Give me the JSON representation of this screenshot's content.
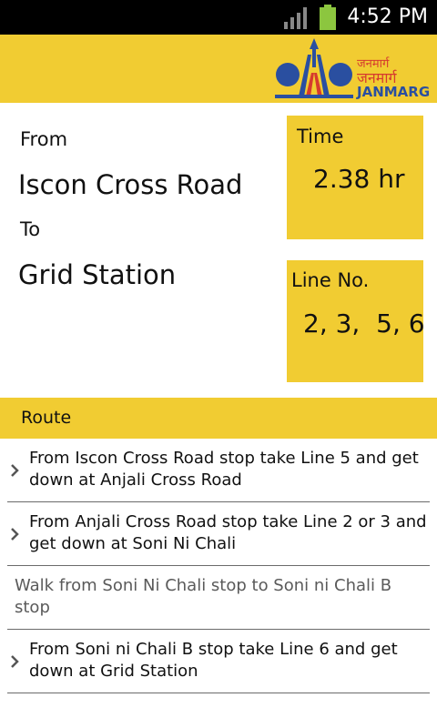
{
  "status_bar": {
    "time": "4:52 PM",
    "icons": [
      "signal-icon",
      "battery-icon"
    ],
    "battery_color": "#8cc63f"
  },
  "header": {
    "brand_hindi_small": "जनमार्ग",
    "brand_hindi_large": "जनमार्ग",
    "brand_name": "JANMARG",
    "accent_color": "#f1cc32"
  },
  "trip": {
    "from_label": "From",
    "from_value": "Iscon Cross Road",
    "to_label": "To",
    "to_value": "Grid Station"
  },
  "time_box": {
    "label": "Time",
    "value": "2.38 hr"
  },
  "line_box": {
    "label": "Line No.",
    "value": "2, 3,  5, 6"
  },
  "route": {
    "header": "Route",
    "steps": [
      {
        "text": "From Iscon Cross Road stop take Line 5 and get down at Anjali Cross Road",
        "icon": "chevron-right-icon"
      },
      {
        "text": "From Anjali Cross Road stop take Line 2 or 3 and get down at Soni Ni Chali",
        "icon": "chevron-right-icon"
      },
      {
        "text": "Walk from Soni Ni Chali stop to Soni ni Chali B stop",
        "icon": ""
      },
      {
        "text": "From Soni ni Chali B stop take Line 6 and get down at Grid Station",
        "icon": "chevron-right-icon"
      }
    ]
  }
}
